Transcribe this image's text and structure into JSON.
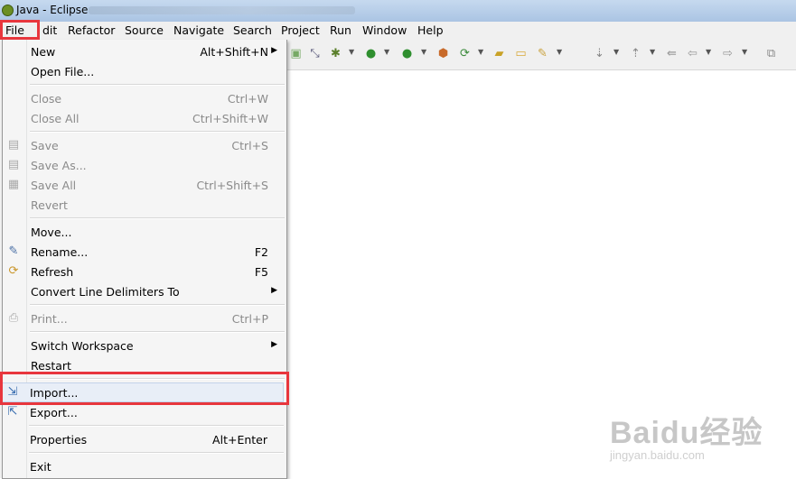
{
  "window": {
    "title": "Java - Eclipse",
    "title_icon": "eclipse-icon"
  },
  "menubar": {
    "items": [
      "File",
      "Edit",
      "Refactor",
      "Source",
      "Navigate",
      "Search",
      "Project",
      "Run",
      "Window",
      "Help"
    ]
  },
  "file_menu": {
    "items": [
      {
        "label": "New",
        "shortcut": "Alt+Shift+N",
        "submenu": true,
        "enabled": true,
        "icon": ""
      },
      {
        "label": "Open File...",
        "shortcut": "",
        "enabled": true,
        "icon": ""
      },
      {
        "label": "Close",
        "shortcut": "Ctrl+W",
        "enabled": false,
        "icon": ""
      },
      {
        "label": "Close All",
        "shortcut": "Ctrl+Shift+W",
        "enabled": false,
        "icon": ""
      },
      {
        "label": "Save",
        "shortcut": "Ctrl+S",
        "enabled": false,
        "icon": "save-icon"
      },
      {
        "label": "Save As...",
        "shortcut": "",
        "enabled": false,
        "icon": "save-as-icon"
      },
      {
        "label": "Save All",
        "shortcut": "Ctrl+Shift+S",
        "enabled": false,
        "icon": "save-all-icon"
      },
      {
        "label": "Revert",
        "shortcut": "",
        "enabled": false,
        "icon": ""
      },
      {
        "label": "Move...",
        "shortcut": "",
        "enabled": true,
        "icon": ""
      },
      {
        "label": "Rename...",
        "shortcut": "F2",
        "enabled": true,
        "icon": "rename-icon"
      },
      {
        "label": "Refresh",
        "shortcut": "F5",
        "enabled": true,
        "icon": "refresh-icon"
      },
      {
        "label": "Convert Line Delimiters To",
        "shortcut": "",
        "submenu": true,
        "enabled": true,
        "icon": ""
      },
      {
        "label": "Print...",
        "shortcut": "Ctrl+P",
        "enabled": false,
        "icon": "print-icon"
      },
      {
        "label": "Switch Workspace",
        "shortcut": "",
        "submenu": true,
        "enabled": true,
        "icon": ""
      },
      {
        "label": "Restart",
        "shortcut": "",
        "enabled": true,
        "icon": ""
      },
      {
        "label": "Import...",
        "shortcut": "",
        "enabled": true,
        "icon": "import-icon",
        "highlighted": true
      },
      {
        "label": "Export...",
        "shortcut": "",
        "enabled": true,
        "icon": "export-icon"
      },
      {
        "label": "Properties",
        "shortcut": "Alt+Enter",
        "enabled": true,
        "icon": ""
      },
      {
        "label": "Exit",
        "shortcut": "",
        "enabled": true,
        "icon": ""
      }
    ]
  },
  "toolbar": {
    "icons": [
      "new-class-icon",
      "link-icon",
      "debug-icon",
      "run-icon",
      "run-external-icon",
      "build-icon",
      "new-wizard-icon",
      "open-type-icon",
      "open-folder-icon",
      "search-icon",
      "next-annotation-icon",
      "previous-annotation-icon",
      "last-edit-icon",
      "back-icon",
      "forward-icon",
      "open-perspective-icon"
    ]
  },
  "watermark": {
    "main": "Baidu经验",
    "sub": "jingyan.baidu.com"
  },
  "colors": {
    "highlight_box": "#e8363d",
    "menu_background": "#f5f5f5",
    "titlebar": "#b9cfe9"
  }
}
